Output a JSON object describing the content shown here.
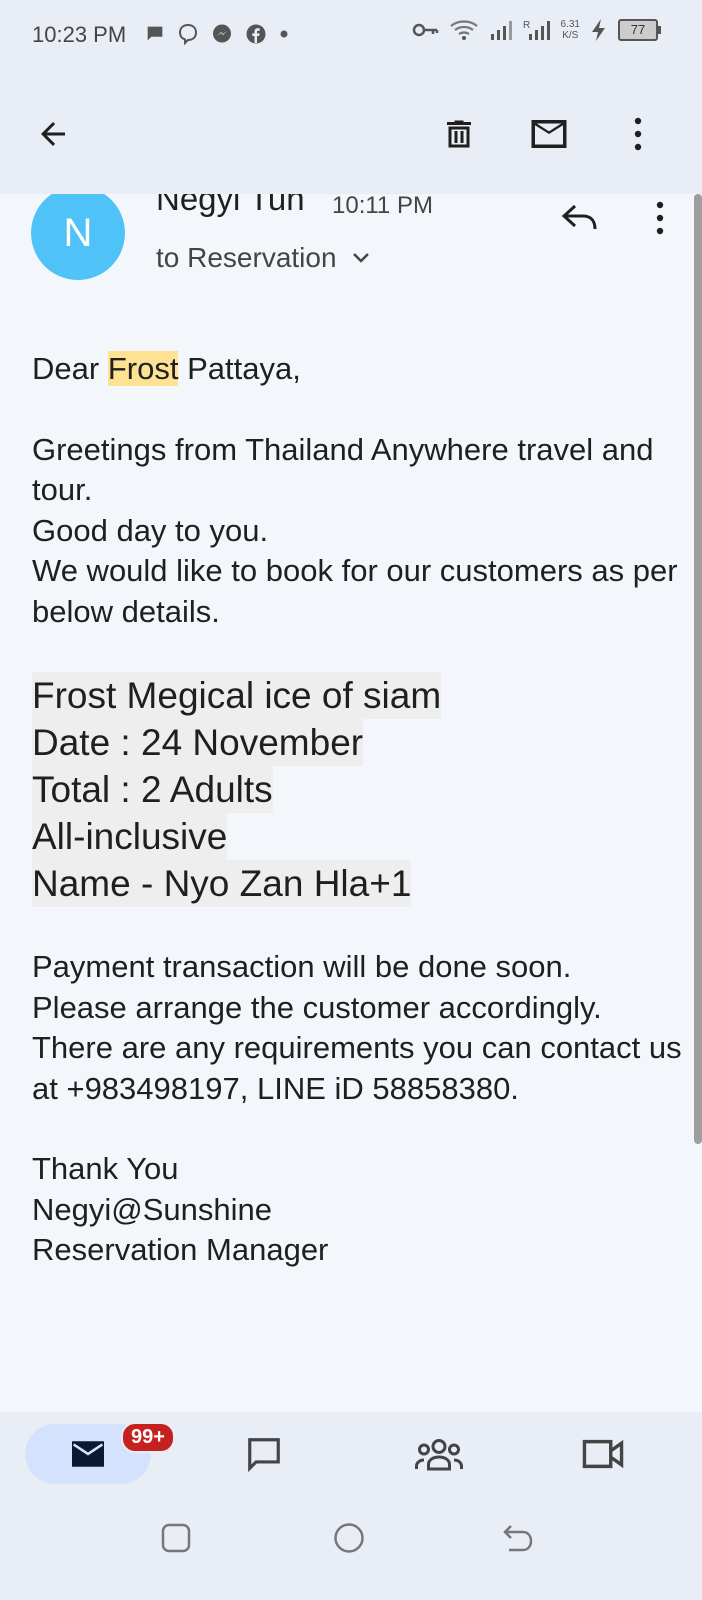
{
  "status_bar": {
    "time": "10:23 PM",
    "net_speed_value": "6.31",
    "net_speed_unit": "K/S",
    "battery": "77",
    "left_icons": [
      "chat-bubble-icon",
      "viber-icon",
      "messenger-icon",
      "facebook-icon",
      "dot-icon"
    ],
    "right_icons": [
      "key-icon",
      "wifi-icon",
      "signal-icon",
      "signal-roaming-icon",
      "charging-icon",
      "battery-icon"
    ]
  },
  "app_bar": {
    "icons": [
      "back-arrow-icon",
      "delete-icon",
      "mark-unread-icon",
      "more-vert-icon"
    ]
  },
  "email": {
    "avatar_letter": "N",
    "sender": "Negyi Tun",
    "time": "10:11 PM",
    "recipient": "to Reservation",
    "greeting_prefix": "Dear",
    "greeting_highlight": "Frost",
    "greeting_suffix": "Pattaya,",
    "intro_lines": [
      "Greetings from Thailand Anywhere travel and tour.",
      "Good day to you.",
      "We would like to book for our customers as per below details."
    ],
    "booking_lines": [
      "Frost Megical ice of siam",
      "Date : 24 November",
      "Total : 2 Adults",
      "All-inclusive",
      "Name - Nyo Zan Hla+1"
    ],
    "closing_lines": [
      "Payment transaction will be done soon.",
      "Please arrange the customer accordingly.",
      "There are any requirements you can contact us at +983498197, LINE iD 58858380."
    ],
    "signature_lines": [
      "Thank You",
      "Negyi@Sunshine",
      "Reservation Manager"
    ]
  },
  "bottom_nav": {
    "mail_badge": "99+",
    "items": [
      "mail-icon",
      "chat-icon",
      "spaces-icon",
      "meet-icon"
    ]
  },
  "colors": {
    "avatar": "#4fc3f7",
    "highlight": "#fde293",
    "badge": "#c5221f",
    "nav_pill": "#d3e3fd"
  }
}
